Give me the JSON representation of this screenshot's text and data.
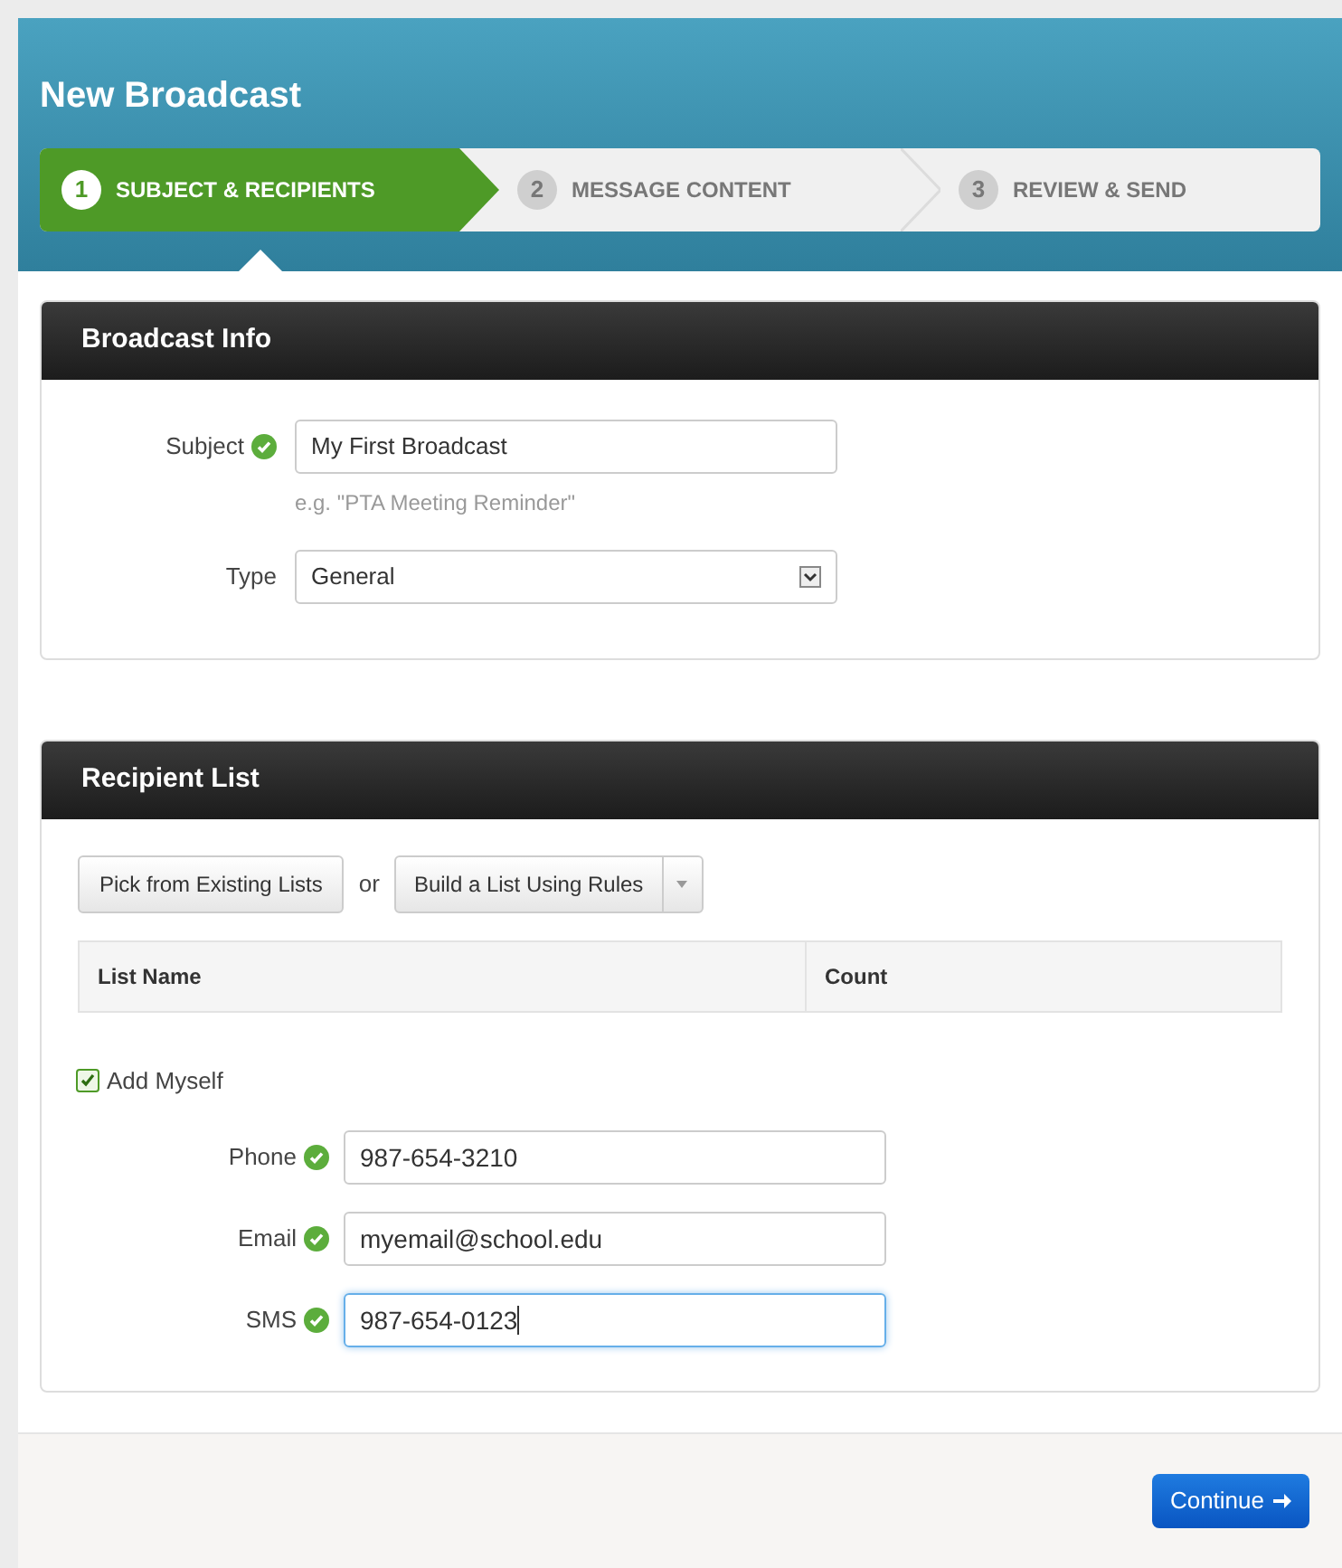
{
  "header": {
    "title": "New Broadcast"
  },
  "steps": [
    {
      "number": "1",
      "label": "SUBJECT & RECIPIENTS",
      "selected": true
    },
    {
      "number": "2",
      "label": "MESSAGE CONTENT",
      "selected": false
    },
    {
      "number": "3",
      "label": "REVIEW & SEND",
      "selected": false
    }
  ],
  "broadcast_info": {
    "title": "Broadcast Info",
    "subject": {
      "label": "Subject",
      "valid": true,
      "value": "My First Broadcast",
      "hint": "e.g. \"PTA Meeting Reminder\""
    },
    "type": {
      "label": "Type",
      "value": "General"
    }
  },
  "recipient_list": {
    "title": "Recipient List",
    "pick_button": "Pick from Existing Lists",
    "or_text": "or",
    "build_button": "Build a List Using Rules",
    "table": {
      "columns": [
        "List Name",
        "Count"
      ]
    },
    "add_myself": {
      "label": "Add Myself",
      "checked": true
    },
    "fields": [
      {
        "label": "Phone",
        "valid": true,
        "value": "987-654-3210",
        "focused": false
      },
      {
        "label": "Email",
        "valid": true,
        "value": "myemail@school.edu",
        "focused": false
      },
      {
        "label": "SMS",
        "valid": true,
        "value": "987-654-0123",
        "focused": true
      }
    ]
  },
  "footer": {
    "continue_button": "Continue"
  }
}
